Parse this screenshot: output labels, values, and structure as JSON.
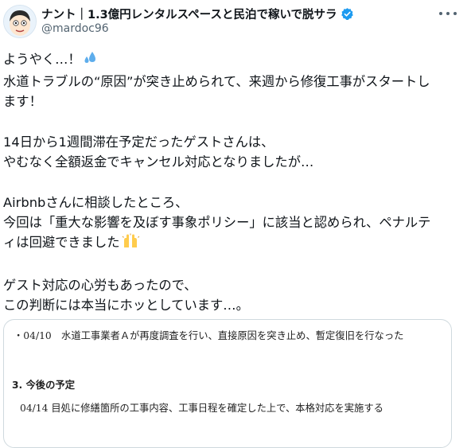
{
  "author": {
    "display_name": "ナント｜1.3億円レンタルスペースと民泊で稼いで脱サラ",
    "handle": "@mardoc96",
    "verified": true
  },
  "icons": {
    "verified": "verified-badge-icon",
    "more": "more-options-icon",
    "drop": "sweat-droplets-emoji",
    "hands": "raising-hands-emoji"
  },
  "colors": {
    "verified_blue": "#1d9bf0",
    "secondary_text": "#536471",
    "card_border": "#cfd9de"
  },
  "tweet": {
    "line1": "ようやく…！",
    "line2": "水道トラブルの“原因”が突き止められて、来週から修復工事がスタートし",
    "line3": "ます！",
    "line4": "14日から1週間滞在予定だったゲストさんは、",
    "line5": "やむなく全額返金でキャンセル対応となりましたが…",
    "line6": "Airbnbさんに相談したところ、",
    "line7": "今回は「重大な影響を及ぼす事象ポリシー」に該当と認められ、ペナルテ",
    "line8": "ィは回避できました",
    "line9": "ゲスト対応の心労もあったので、",
    "line10": "この判断には本当にホッとしています…。"
  },
  "attachment": {
    "entry_0410": "・04/10　水道工事業者Ａが再度調査を行い、直接原因を突き止め、暫定復旧を行なった",
    "section_heading": "3. 今後の予定",
    "entry_0414": "04/14 目処に修繕箇所の工事内容、工事日程を確定した上で、本格対応を実施する"
  }
}
